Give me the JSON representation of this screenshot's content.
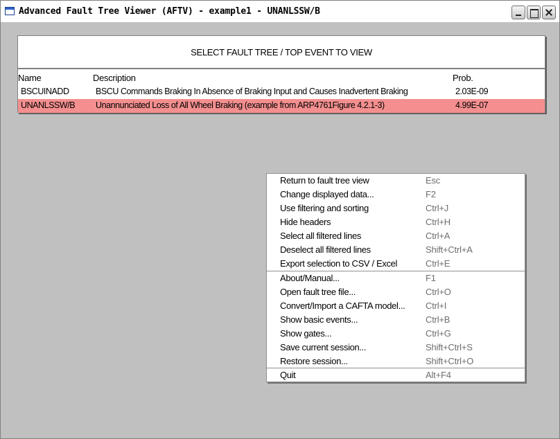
{
  "window": {
    "title": "Advanced Fault Tree Viewer (AFTV) - example1 - UNANLSSW/B"
  },
  "panel": {
    "header": "SELECT FAULT TREE / TOP EVENT TO VIEW",
    "columns": {
      "name": "Name",
      "description": "Description",
      "prob": "Prob."
    },
    "rows": [
      {
        "name": "BSCUINADD",
        "description": "BSCU Commands Braking In Absence of Braking Input and Causes Inadvertent Braking",
        "prob": "2.03E-09",
        "selected": false
      },
      {
        "name": "UNANLSSW/B",
        "description": "Unannunciated Loss of All Wheel Braking (example from ARP4761Figure 4.2.1-3)",
        "prob": "4.99E-07",
        "selected": true
      }
    ],
    "highlight_color": "#f48f8f"
  },
  "menu": {
    "items": [
      {
        "label": "Return to fault tree view",
        "shortcut": "Esc"
      },
      {
        "label": "Change displayed data...",
        "shortcut": "F2"
      },
      {
        "label": "Use filtering and sorting",
        "shortcut": "Ctrl+J"
      },
      {
        "label": "Hide headers",
        "shortcut": "Ctrl+H"
      },
      {
        "label": "Select all filtered lines",
        "shortcut": "Ctrl+A"
      },
      {
        "label": "Deselect all filtered lines",
        "shortcut": "Shift+Ctrl+A"
      },
      {
        "label": "Export selection to CSV / Excel",
        "shortcut": "Ctrl+E"
      },
      {
        "label": "About/Manual...",
        "shortcut": "F1"
      },
      {
        "label": "Open fault tree file...",
        "shortcut": "Ctrl+O"
      },
      {
        "label": "Convert/Import a CAFTA model...",
        "shortcut": "Ctrl+I"
      },
      {
        "label": "Show basic events...",
        "shortcut": "Ctrl+B"
      },
      {
        "label": "Show gates...",
        "shortcut": "Ctrl+G"
      },
      {
        "label": "Save current session...",
        "shortcut": "Shift+Ctrl+S"
      },
      {
        "label": "Restore session...",
        "shortcut": "Shift+Ctrl+O"
      },
      {
        "label": "Quit",
        "shortcut": "Alt+F4"
      }
    ]
  }
}
